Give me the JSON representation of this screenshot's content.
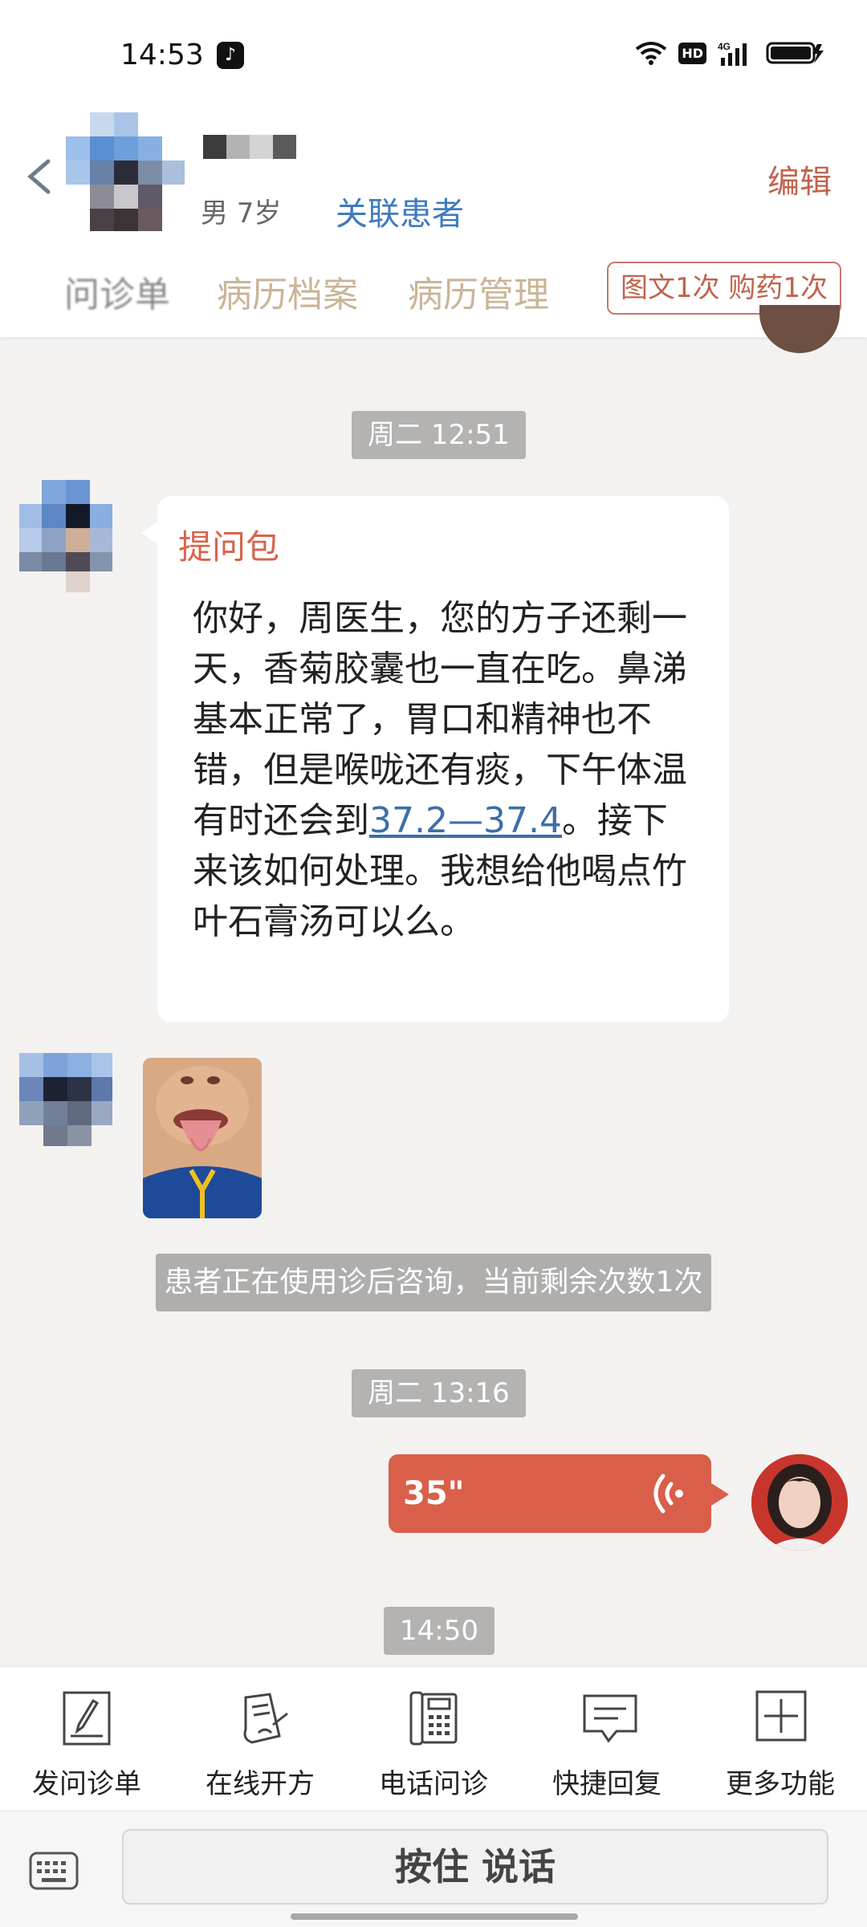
{
  "status_bar": {
    "time": "14:53",
    "tiktok_glyph": "♪",
    "hd_label": "HD",
    "network_label": "4G"
  },
  "header": {
    "patient_meta": "男 7岁",
    "link_patient_label": "关联患者",
    "edit_label": "编辑",
    "tabs": [
      {
        "label": "问诊单"
      },
      {
        "label": "病历档案"
      },
      {
        "label": "病历管理"
      }
    ],
    "quota_badge": "图文1次 购药1次"
  },
  "messages": {
    "time_1": "周二 12:51",
    "bubble_title": "提问包",
    "bubble_text_1": "你好，周医生，您的方子还剩一天，香菊胶囊也一直在吃。鼻涕基本正常了，胃口和精神也不错，但是喉咙还有痰，下午体温有时还会到",
    "bubble_link": "37.2—37.4",
    "bubble_text_2": "。接下来该如何处理。我想给他喝点竹叶石膏汤可以么。",
    "system_notice": "患者正在使用诊后咨询，当前剩余次数1次",
    "time_2": "周二 13:16",
    "voice_duration": "35\"",
    "time_3": "14:50"
  },
  "toolbar": {
    "items": [
      {
        "label": "发问诊单",
        "icon": "form-edit-icon"
      },
      {
        "label": "在线开方",
        "icon": "prescription-icon"
      },
      {
        "label": "电话问诊",
        "icon": "phone-icon"
      },
      {
        "label": "快捷回复",
        "icon": "chat-bubble-icon"
      },
      {
        "label": "更多功能",
        "icon": "plus-box-icon"
      }
    ]
  },
  "input": {
    "hold_to_talk_label": "按住 说话"
  },
  "colors": {
    "accent": "#d95f4a",
    "link": "#3d7bbf",
    "tab_text": "#c9b597"
  }
}
